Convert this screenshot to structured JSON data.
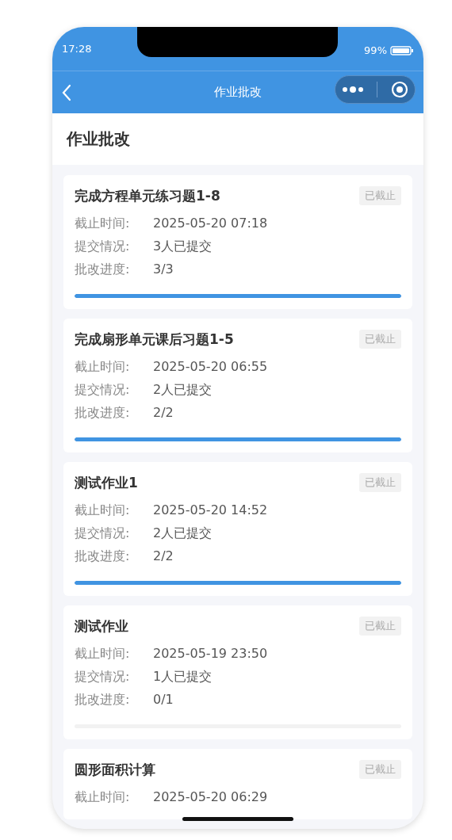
{
  "status_bar": {
    "time": "17:28",
    "battery": "99%"
  },
  "nav_bar": {
    "title": "作业批改"
  },
  "page": {
    "heading": "作业批改"
  },
  "assignments": [
    {
      "title": "完成方程单元练习题1-8",
      "status": "已截止",
      "fields": [
        {
          "label": "截止时间:",
          "value": "2025-05-20 07:18"
        },
        {
          "label": "提交情况:",
          "value": "3人已提交"
        },
        {
          "label": "批改进度:",
          "value": "3/3"
        }
      ],
      "level": 1
    },
    {
      "title": "完成扇形单元课后习题1-5",
      "status": "已截止",
      "fields": [
        {
          "label": "截止时间:",
          "value": "2025-05-20 06:55"
        },
        {
          "label": "提交情况:",
          "value": "2人已提交"
        },
        {
          "label": "批改进度:",
          "value": "2/2"
        }
      ],
      "level": 1
    },
    {
      "title": "测试作业1",
      "status": "已截止",
      "fields": [
        {
          "label": "截止时间:",
          "value": "2025-05-20 14:52"
        },
        {
          "label": "提交情况:",
          "value": "2人已提交"
        },
        {
          "label": "批改进度:",
          "value": "2/2"
        }
      ],
      "level": 1
    },
    {
      "title": "测试作业",
      "status": "已截止",
      "fields": [
        {
          "label": "截止时间:",
          "value": "2025-05-19 23:50"
        },
        {
          "label": "提交情况:",
          "value": "1人已提交"
        },
        {
          "label": "批改进度:",
          "value": "0/1"
        }
      ],
      "level": 0
    },
    {
      "title": "圆形面积计算",
      "status": "已截止",
      "fields": [
        {
          "label": "截止时间:",
          "value": "2025-05-20 06:29"
        }
      ]
    }
  ]
}
